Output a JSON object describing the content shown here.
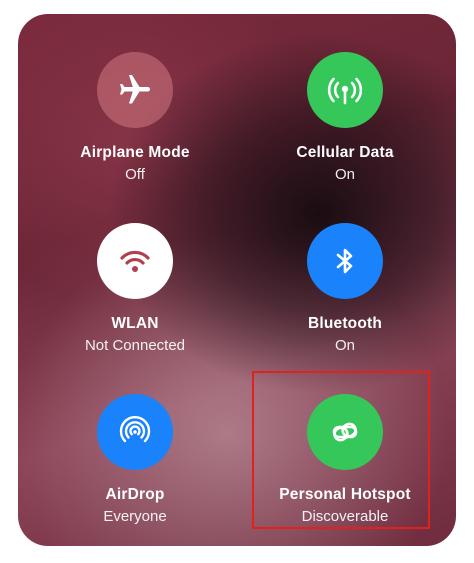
{
  "controls": [
    {
      "title": "Airplane Mode",
      "subtitle": "Off",
      "icon": "airplane-icon",
      "state": "off"
    },
    {
      "title": "Cellular Data",
      "subtitle": "On",
      "icon": "antenna-icon",
      "state": "on"
    },
    {
      "title": "WLAN",
      "subtitle": "Not Connected",
      "icon": "wifi-icon",
      "state": "off"
    },
    {
      "title": "Bluetooth",
      "subtitle": "On",
      "icon": "bluetooth-icon",
      "state": "on"
    },
    {
      "title": "AirDrop",
      "subtitle": "Everyone",
      "icon": "airdrop-icon",
      "state": "on"
    },
    {
      "title": "Personal Hotspot",
      "subtitle": "Discoverable",
      "icon": "link-icon",
      "state": "on"
    }
  ],
  "colors": {
    "green": "#35c759",
    "blue": "#1a82fb",
    "highlight_border": "#e0221e"
  }
}
